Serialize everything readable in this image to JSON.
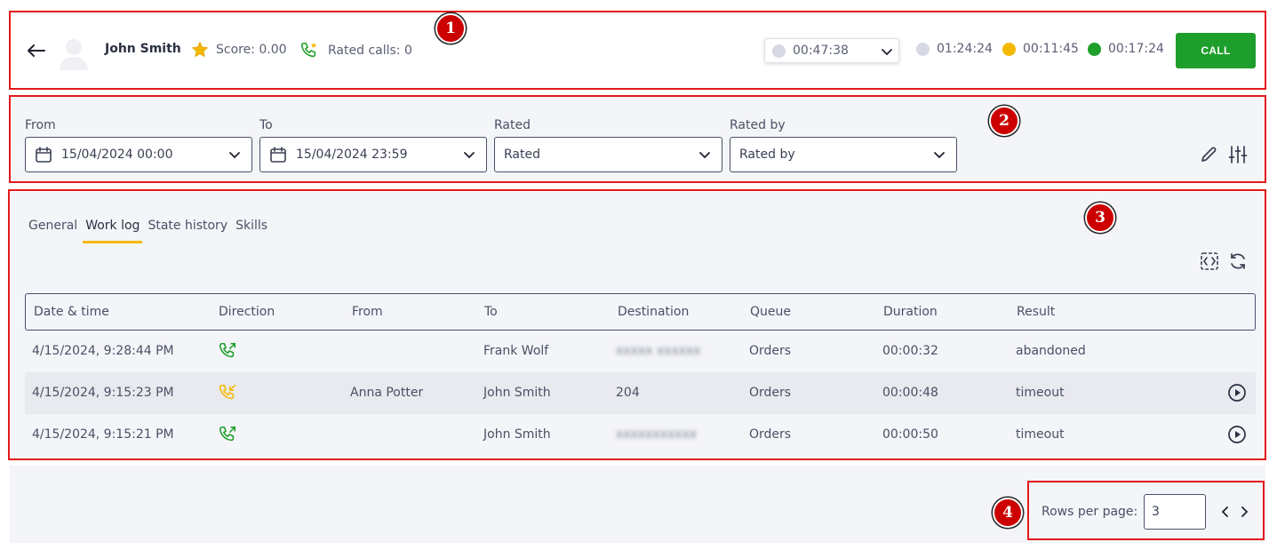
{
  "header": {
    "agent_name": "John Smith",
    "score_label": "Score: 0.00",
    "rated_calls_label": "Rated calls: 0",
    "status_timer": "00:47:38",
    "timers": [
      {
        "value": "01:24:24",
        "color": "#d6d9e3"
      },
      {
        "value": "00:11:45",
        "color": "#f5b800"
      },
      {
        "value": "00:17:24",
        "color": "#1e9e2a"
      }
    ],
    "status_color": "#d6d9e3",
    "call_label": "CALL"
  },
  "filters": {
    "from_label": "From",
    "from_value": "15/04/2024 00:00",
    "to_label": "To",
    "to_value": "15/04/2024 23:59",
    "rated_label": "Rated",
    "rated_value": "Rated",
    "rated_by_label": "Rated by",
    "rated_by_value": "Rated by"
  },
  "tabs": [
    "General",
    "Work log",
    "State history",
    "Skills"
  ],
  "table": {
    "columns": [
      "Date & time",
      "Direction",
      "From",
      "To",
      "Destination",
      "Queue",
      "Duration",
      "Result"
    ],
    "rows": [
      {
        "datetime": "4/15/2024, 9:28:44 PM",
        "direction": "outgoing",
        "from": "",
        "to": "Frank Wolf",
        "destination": "xxxxx xxxxxx",
        "queue": "Orders",
        "duration": "00:00:32",
        "result": "abandoned",
        "has_recording": false
      },
      {
        "datetime": "4/15/2024, 9:15:23 PM",
        "direction": "incoming",
        "from": "Anna Potter",
        "to": "John Smith",
        "destination": "204",
        "queue": "Orders",
        "duration": "00:00:48",
        "result": "timeout",
        "has_recording": true
      },
      {
        "datetime": "4/15/2024, 9:15:21 PM",
        "direction": "outgoing",
        "from": "",
        "to": "John Smith",
        "destination": "xxxxxxxxxxx",
        "queue": "Orders",
        "duration": "00:00:50",
        "result": "timeout",
        "has_recording": true
      }
    ]
  },
  "pagination": {
    "rows_per_page_label": "Rows per page:",
    "rows_per_page_value": "3"
  },
  "annotations": [
    "1",
    "2",
    "3",
    "4"
  ],
  "colors": {
    "accent_yellow": "#f5b800",
    "call_green": "#1e9e2a",
    "annotation_red": "#e3191c"
  }
}
